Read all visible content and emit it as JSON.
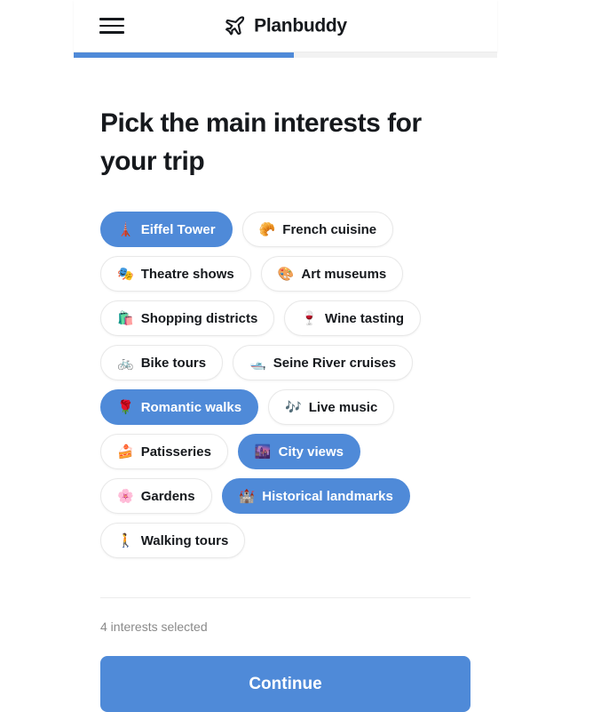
{
  "header": {
    "menu_icon": "hamburger-menu-icon",
    "logo_icon": "airplane-icon",
    "brand_name": "Planbuddy"
  },
  "progress": {
    "percent": 52
  },
  "main": {
    "title": "Pick the main interests for your trip",
    "interests": [
      {
        "emoji": "🗼",
        "icon_name": "tokyo-tower-icon",
        "label": "Eiffel Tower",
        "selected": true
      },
      {
        "emoji": "🥐",
        "icon_name": "croissant-icon",
        "label": "French cuisine",
        "selected": false
      },
      {
        "emoji": "🎭",
        "icon_name": "performing-arts-icon",
        "label": "Theatre shows",
        "selected": false
      },
      {
        "emoji": "🎨",
        "icon_name": "artist-palette-icon",
        "label": "Art museums",
        "selected": false
      },
      {
        "emoji": "🛍️",
        "icon_name": "shopping-bags-icon",
        "label": "Shopping districts",
        "selected": false
      },
      {
        "emoji": "🍷",
        "icon_name": "wine-glass-icon",
        "label": "Wine tasting",
        "selected": false
      },
      {
        "emoji": "🚲",
        "icon_name": "bicycle-icon",
        "label": "Bike tours",
        "selected": false
      },
      {
        "emoji": "🛥️",
        "icon_name": "motor-boat-icon",
        "label": "Seine River cruises",
        "selected": false
      },
      {
        "emoji": "🌹",
        "icon_name": "rose-icon",
        "label": "Romantic walks",
        "selected": true
      },
      {
        "emoji": "🎶",
        "icon_name": "musical-notes-icon",
        "label": "Live music",
        "selected": false
      },
      {
        "emoji": "🍰",
        "icon_name": "cake-slice-icon",
        "label": "Patisseries",
        "selected": false
      },
      {
        "emoji": "🌆",
        "icon_name": "cityscape-dusk-icon",
        "label": "City views",
        "selected": true
      },
      {
        "emoji": "🌸",
        "icon_name": "cherry-blossom-icon",
        "label": "Gardens",
        "selected": false
      },
      {
        "emoji": "🏰",
        "icon_name": "castle-icon",
        "label": "Historical landmarks",
        "selected": true
      },
      {
        "emoji": "🚶",
        "icon_name": "walking-person-icon",
        "label": "Walking tours",
        "selected": false
      }
    ]
  },
  "footer": {
    "selection_count_text": "4 interests selected",
    "continue_label": "Continue"
  },
  "colors": {
    "accent": "#4f8ad8",
    "text": "#16191d",
    "muted": "#8a8a8a",
    "chip_border": "#e8e8e8"
  }
}
